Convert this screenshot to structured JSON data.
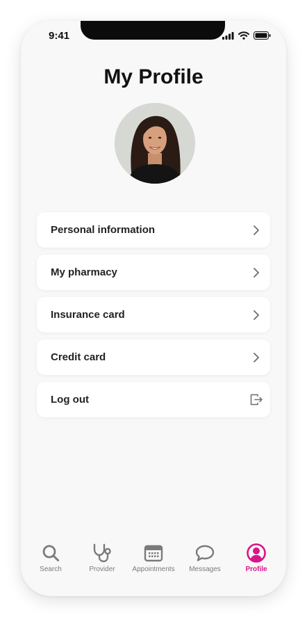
{
  "status": {
    "time": "9:41"
  },
  "header": {
    "title": "My Profile"
  },
  "menu": {
    "items": [
      {
        "label": "Personal information",
        "icon": "chevron-right-icon"
      },
      {
        "label": "My pharmacy",
        "icon": "chevron-right-icon"
      },
      {
        "label": "Insurance card",
        "icon": "chevron-right-icon"
      },
      {
        "label": "Credit card",
        "icon": "chevron-right-icon"
      },
      {
        "label": "Log out",
        "icon": "logout-icon"
      }
    ]
  },
  "tabbar": {
    "active": "Profile",
    "items": [
      {
        "label": "Search",
        "icon": "search-icon"
      },
      {
        "label": "Provider",
        "icon": "stethoscope-icon"
      },
      {
        "label": "Appointments",
        "icon": "calendar-icon"
      },
      {
        "label": "Messages",
        "icon": "chat-bubble-icon"
      },
      {
        "label": "Profile",
        "icon": "user-circle-icon"
      }
    ]
  },
  "colors": {
    "accent": "#d8168a",
    "inactive": "#7b7b7b",
    "background": "#f8f8f8"
  }
}
